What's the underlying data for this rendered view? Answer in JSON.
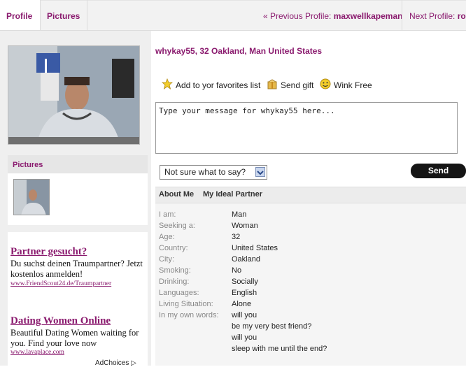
{
  "tabs": [
    {
      "label": "Profile"
    },
    {
      "label": "Pictures"
    }
  ],
  "nav": {
    "prev_prefix": "« Previous Profile:",
    "prev_name": "maxwellkapeman",
    "next_prefix": "Next Profile:",
    "next_name": "royj"
  },
  "profile": {
    "title": "whykay55, 32 Oakland, Man United States"
  },
  "actions": [
    {
      "label": "Add to yor favorites list",
      "icon": "star-icon"
    },
    {
      "label": "Send gift",
      "icon": "gift-icon"
    },
    {
      "label": "Wink Free",
      "icon": "smiley-icon"
    }
  ],
  "message": {
    "placeholder": "Type your message for whykay55 here..."
  },
  "suggest": {
    "selected": "Not sure what to say?"
  },
  "send_label": "Send",
  "pictures_title": "Pictures",
  "details_tabs": [
    {
      "label": "About Me"
    },
    {
      "label": "My Ideal Partner"
    }
  ],
  "details": [
    {
      "label": "I am:",
      "value": "Man"
    },
    {
      "label": "Seeking a:",
      "value": "Woman"
    },
    {
      "label": "Age:",
      "value": "32"
    },
    {
      "label": "Country:",
      "value": "United States"
    },
    {
      "label": "City:",
      "value": "Oakland"
    },
    {
      "label": "Smoking:",
      "value": "No"
    },
    {
      "label": "Drinking:",
      "value": "Socially"
    },
    {
      "label": "Languages:",
      "value": "English"
    },
    {
      "label": "Living Situation:",
      "value": "Alone"
    },
    {
      "label": "In my own words:",
      "value": "will you"
    }
  ],
  "own_words_more": [
    "be my very best friend?",
    "will you",
    "sleep with me until the end?"
  ],
  "ads": [
    {
      "title": "Partner gesucht?",
      "text": "Du suchst deinen Traumpartner? Jetzt kostenlos anmelden!",
      "url": "www.FriendScout24.de/Traumpartner"
    },
    {
      "title": "Dating Women Online",
      "text": "Beautiful Dating Women waiting for you. Find your love now",
      "url": "www.lavaplace.com"
    }
  ],
  "adchoices": "AdChoices ▷",
  "colors": {
    "accent": "#8a1a6e",
    "send_bg": "#151515"
  }
}
